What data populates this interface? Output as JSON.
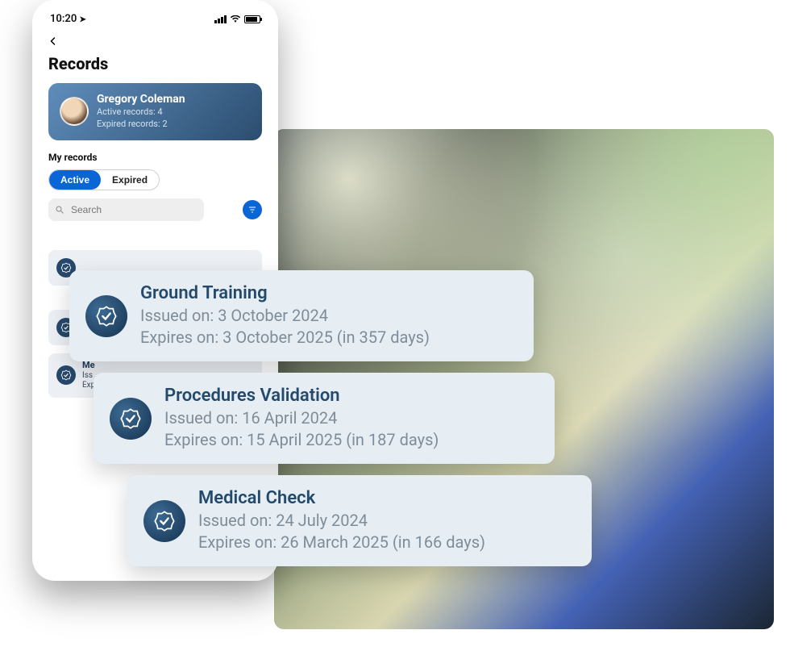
{
  "status": {
    "time": "10:20",
    "loc_icon": "location-arrow"
  },
  "page": {
    "title": "Records"
  },
  "user": {
    "name": "Gregory Coleman",
    "active_label": "Active records: 4",
    "expired_label": "Expired records: 2"
  },
  "section_label": "My records",
  "tabs": {
    "active": "Active",
    "expired": "Expired"
  },
  "search": {
    "placeholder": "Search"
  },
  "mini_items": [
    {
      "title": "",
      "line1": "",
      "line2": ""
    },
    {
      "title": "Me",
      "line1": "Iss",
      "line2": "Exp"
    }
  ],
  "records": [
    {
      "title": "Ground Training",
      "issued": "Issued on: 3 October 2024",
      "expires": "Expires on: 3 October 2025 (in 357 days)"
    },
    {
      "title": "Procedures Validation",
      "issued": "Issued on: 16 April 2024",
      "expires": "Expires on: 15 April 2025 (in 187 days)"
    },
    {
      "title": "Medical Check",
      "issued": "Issued on: 24 July 2024",
      "expires": "Expires on: 26 March 2025 (in 166 days)"
    }
  ]
}
